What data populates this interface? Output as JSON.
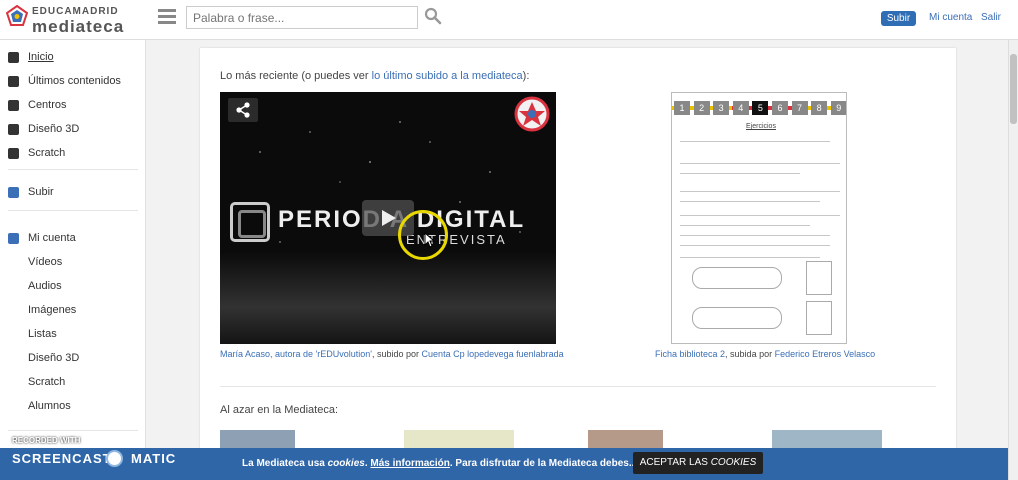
{
  "header": {
    "logo_top": "EDUCAMADRID",
    "logo_bottom": "mediateca",
    "search_placeholder": "Palabra o frase...",
    "upload_label": "Subir",
    "account_label": "Mi cuenta",
    "exit_label": "Salir"
  },
  "sidebar": {
    "items": [
      {
        "label": "Inicio",
        "icon": "home-icon"
      },
      {
        "label": "Últimos contenidos",
        "icon": "file-icon"
      },
      {
        "label": "Centros",
        "icon": "building-icon"
      },
      {
        "label": "Diseño 3D",
        "icon": "cube-icon"
      },
      {
        "label": "Scratch",
        "icon": "scratch-icon"
      }
    ],
    "upload": {
      "label": "Subir",
      "icon": "upload-icon"
    },
    "account": {
      "label": "Mi cuenta",
      "icon": "user-icon"
    },
    "sub_items": [
      "Vídeos",
      "Audios",
      "Imágenes",
      "Listas",
      "Diseño 3D",
      "Scratch",
      "Alumnos"
    ]
  },
  "main": {
    "recent_prefix": "Lo más reciente (o puedes ver ",
    "recent_link": "lo último subido a la mediateca",
    "recent_suffix": "):",
    "video": {
      "title_line1": "PERIOD  A DIGITAL",
      "title_line2": "ENTREVISTA"
    },
    "caption_left": {
      "title": "María Acaso, autora de 'rEDUvolution'",
      "by": ", subido por ",
      "author": "Cuenta Cp lopedevega fuenlabrada"
    },
    "caption_right": {
      "title": "Ficha biblioteca 2",
      "by": ", subida por ",
      "author": "Federico Etreros Velasco"
    },
    "doc": {
      "pages": [
        "1",
        "2",
        "3",
        "4",
        "5",
        "6",
        "7",
        "8",
        "9"
      ],
      "active_page": "5",
      "heading": "Ejercicios"
    },
    "random_title": "Al azar en la Mediateca:"
  },
  "cookie": {
    "text_1": "La Mediateca usa ",
    "text_cookies": "cookies",
    "text_2": ". ",
    "more": "Más información",
    "text_3": ". Para disfrutar de la Mediateca debes...",
    "accept_1": "ACEPTAR LAS ",
    "accept_2": "COOKIES"
  },
  "watermark": {
    "recorded": "RECORDED WITH",
    "screencast": "SCREENCAST",
    "matic": "MATIC"
  },
  "colors": {
    "accent": "#2f6db5",
    "cookie_bar": "#2f66a8",
    "brand_red": "#d9333f"
  }
}
